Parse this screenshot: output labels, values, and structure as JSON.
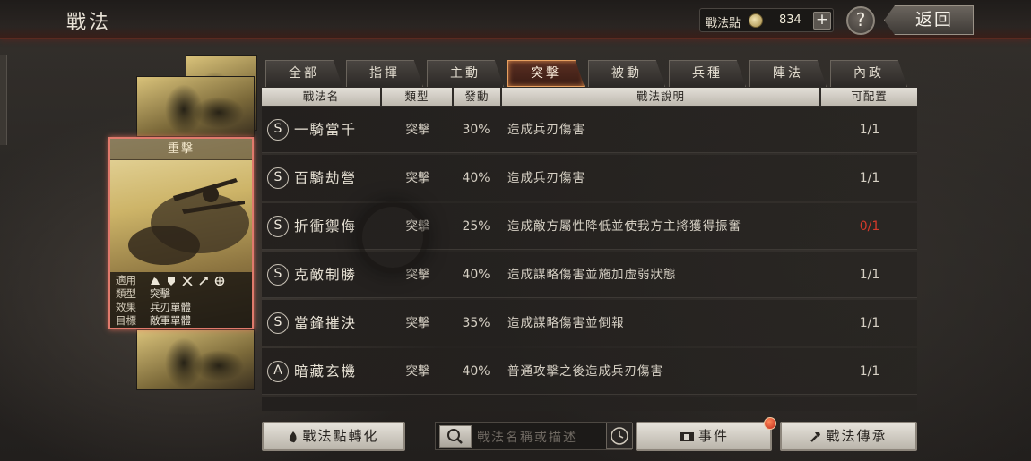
{
  "header": {
    "title": "戰法",
    "points_label": "戰法點",
    "points_value": "834",
    "help_label": "?",
    "back_label": "返回"
  },
  "tabs": [
    {
      "label": "全部"
    },
    {
      "label": "指揮"
    },
    {
      "label": "主動"
    },
    {
      "label": "突擊",
      "active": true
    },
    {
      "label": "被動"
    },
    {
      "label": "兵種"
    },
    {
      "label": "陣法"
    },
    {
      "label": "內政"
    }
  ],
  "columns": [
    "戰法名",
    "類型",
    "發動",
    "戰法說明",
    "可配置"
  ],
  "rows": [
    {
      "grade": "S",
      "name": "一騎當千",
      "type": "突擊",
      "rate": "30%",
      "desc": "造成兵刃傷害",
      "config": "1/1",
      "unavailable": false
    },
    {
      "grade": "S",
      "name": "百騎劫營",
      "type": "突擊",
      "rate": "40%",
      "desc": "造成兵刃傷害",
      "config": "1/1",
      "unavailable": false
    },
    {
      "grade": "S",
      "name": "折衝禦侮",
      "type": "突擊",
      "rate": "25%",
      "desc": "造成敵方屬性降低並使我方主將獲得振奮",
      "config": "0/1",
      "unavailable": true
    },
    {
      "grade": "S",
      "name": "克敵制勝",
      "type": "突擊",
      "rate": "40%",
      "desc": "造成謀略傷害並施加虛弱狀態",
      "config": "1/1",
      "unavailable": false
    },
    {
      "grade": "S",
      "name": "當鋒摧決",
      "type": "突擊",
      "rate": "35%",
      "desc": "造成謀略傷害並倒報",
      "config": "1/1",
      "unavailable": false
    },
    {
      "grade": "A",
      "name": "暗藏玄機",
      "type": "突擊",
      "rate": "40%",
      "desc": "普通攻擊之後造成兵刃傷害",
      "config": "1/1",
      "unavailable": false
    }
  ],
  "card": {
    "name": "重擊",
    "labels": {
      "applies": "適用",
      "type": "類型",
      "effect": "效果",
      "target": "目標"
    },
    "type": "突擊",
    "effect": "兵刃單體",
    "target": "敵軍單體",
    "unit_icons": [
      "cavalry-icon",
      "shield-icon",
      "bow-icon",
      "spear-icon",
      "siege-icon"
    ]
  },
  "bottom": {
    "convert_label": "戰法點轉化",
    "search_placeholder": "戰法名稱或描述",
    "events_label": "事件",
    "inherit_label": "戰法傳承"
  },
  "colors": {
    "active_tab_border": "#e7a060",
    "unavailable_text": "#d23a2a",
    "card_border": "#e07a6c"
  }
}
